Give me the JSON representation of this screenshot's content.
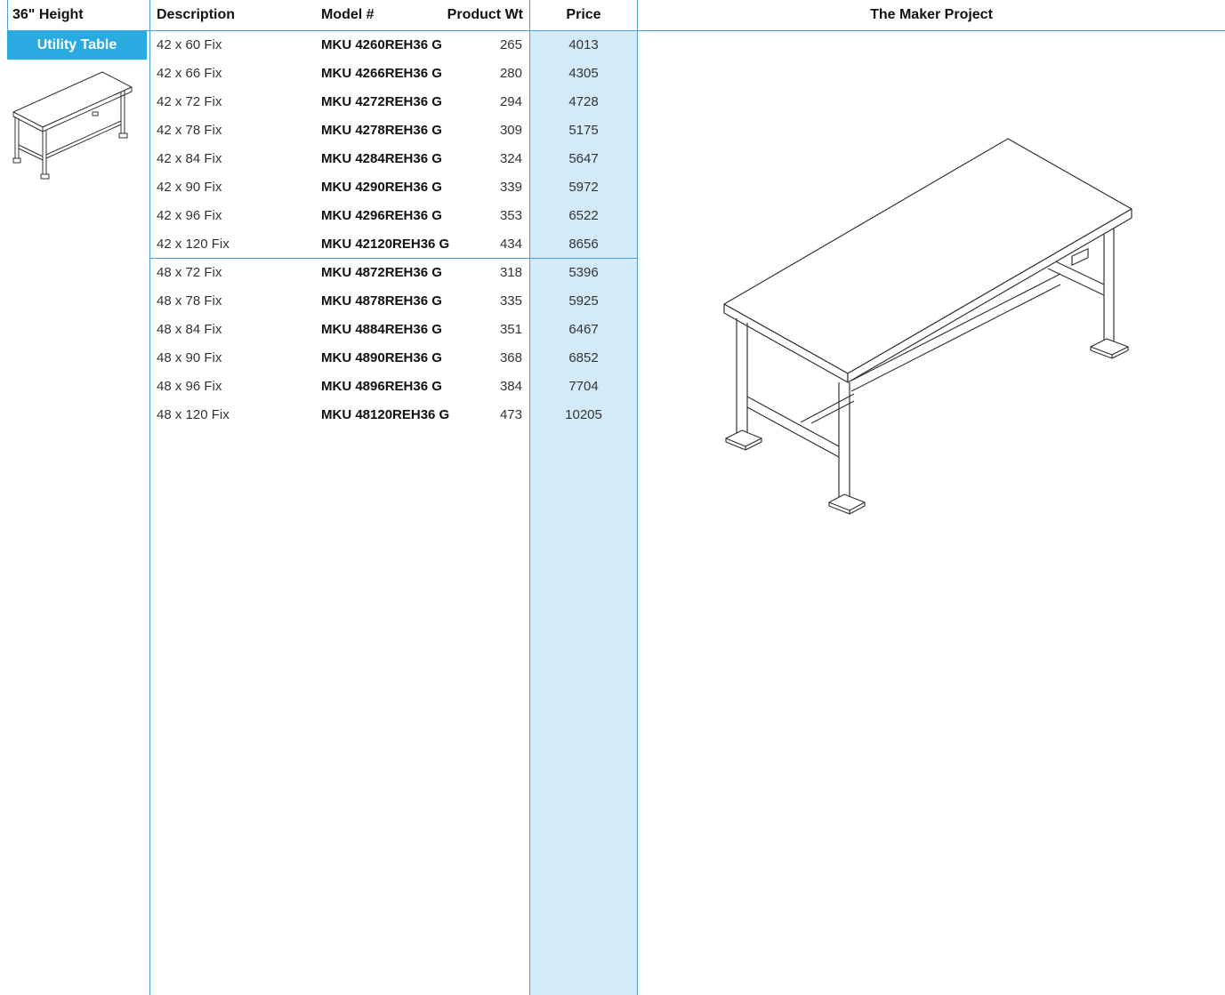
{
  "headers": {
    "height": "36\" Height",
    "description": "Description",
    "model": "Model #",
    "weight": "Product Wt",
    "price": "Price",
    "project": "The Maker Project"
  },
  "category": "Utility Table",
  "colors": {
    "accent": "#29abe2",
    "rule": "#4a9fd0",
    "price_column": "#d3ebf8"
  },
  "icons": {
    "thumbnail": "utility-table-thumbnail-icon",
    "illustration": "utility-table-illustration"
  },
  "rows": [
    {
      "desc": "42 x 60 Fix",
      "model": "MKU 4260REH36 G",
      "wt": "265",
      "price": "4013"
    },
    {
      "desc": "42 x 66 Fix",
      "model": "MKU 4266REH36 G",
      "wt": "280",
      "price": "4305"
    },
    {
      "desc": "42 x 72 Fix",
      "model": "MKU 4272REH36 G",
      "wt": "294",
      "price": "4728"
    },
    {
      "desc": "42 x 78 Fix",
      "model": "MKU 4278REH36 G",
      "wt": "309",
      "price": "5175"
    },
    {
      "desc": "42 x 84 Fix",
      "model": "MKU 4284REH36 G",
      "wt": "324",
      "price": "5647"
    },
    {
      "desc": "42 x 90 Fix",
      "model": "MKU 4290REH36 G",
      "wt": "339",
      "price": "5972"
    },
    {
      "desc": "42 x 96 Fix",
      "model": "MKU 4296REH36 G",
      "wt": "353",
      "price": "6522"
    },
    {
      "desc": "42 x 120 Fix",
      "model": "MKU 42120REH36 G",
      "wt": "434",
      "price": "8656"
    },
    {
      "desc": "48 x 72 Fix",
      "model": "MKU 4872REH36 G",
      "wt": "318",
      "price": "5396"
    },
    {
      "desc": "48 x 78 Fix",
      "model": "MKU 4878REH36 G",
      "wt": "335",
      "price": "5925"
    },
    {
      "desc": "48 x 84 Fix",
      "model": "MKU 4884REH36 G",
      "wt": "351",
      "price": "6467"
    },
    {
      "desc": "48 x 90 Fix",
      "model": "MKU 4890REH36 G",
      "wt": "368",
      "price": "6852"
    },
    {
      "desc": "48 x 96 Fix",
      "model": "MKU 4896REH36 G",
      "wt": "384",
      "price": "7704"
    },
    {
      "desc": "48 x 120 Fix",
      "model": "MKU 48120REH36 G",
      "wt": "473",
      "price": "10205"
    }
  ]
}
